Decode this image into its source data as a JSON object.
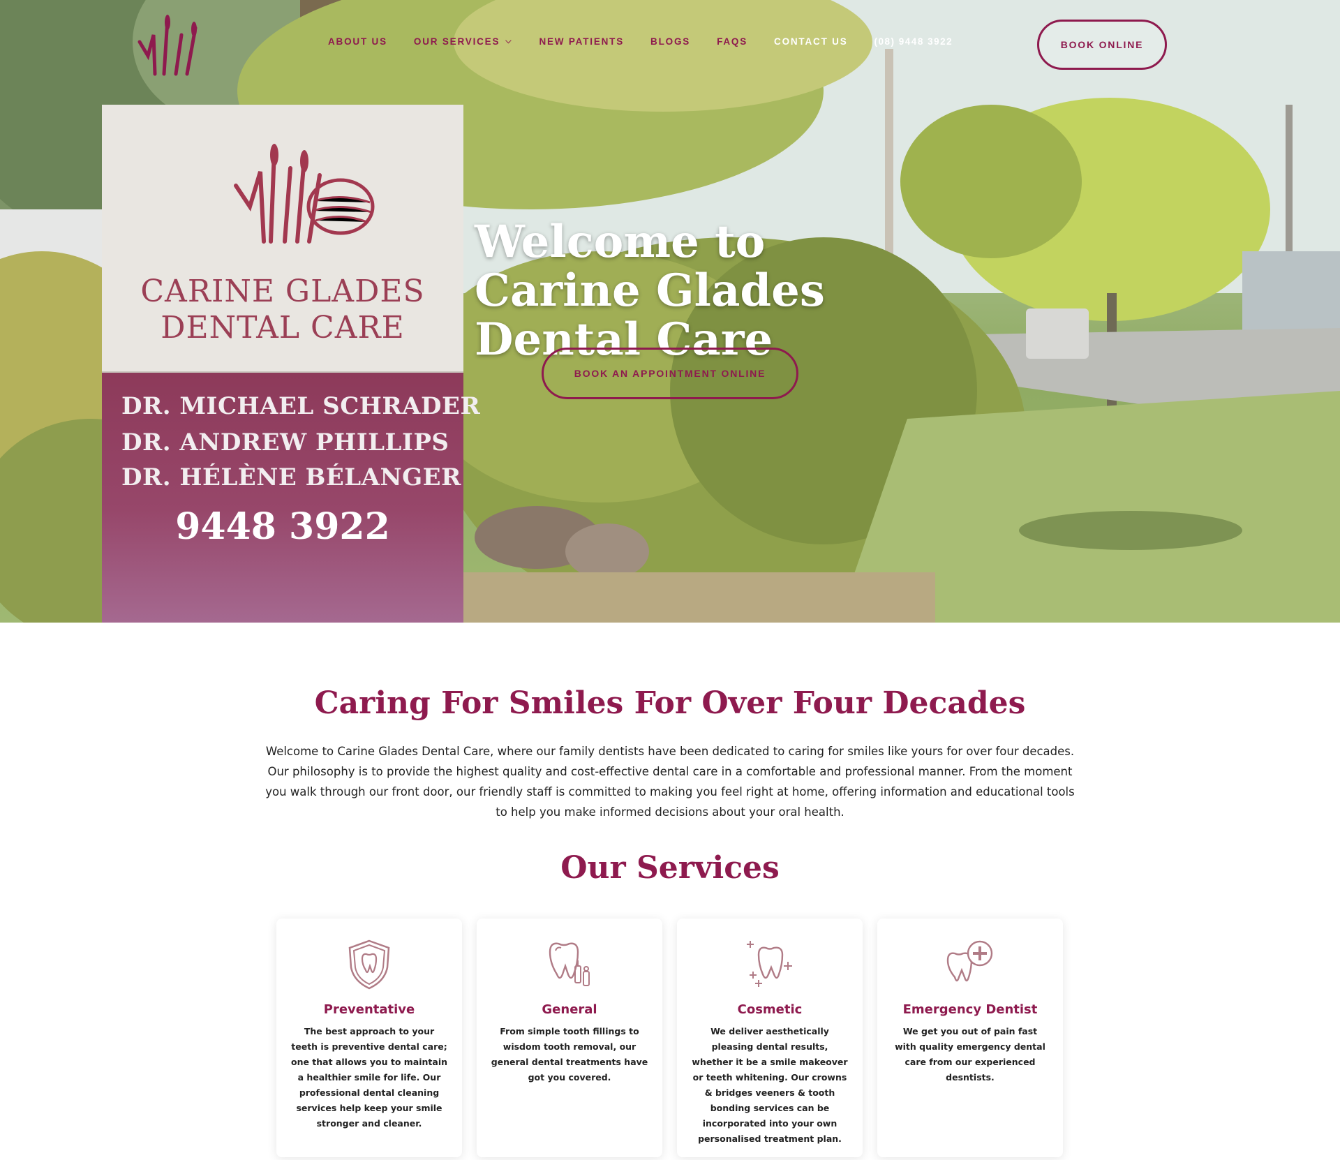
{
  "header": {
    "nav": [
      {
        "label": "ABOUT US",
        "has_dropdown": false
      },
      {
        "label": "OUR SERVICES",
        "has_dropdown": true
      },
      {
        "label": "NEW PATIENTS",
        "has_dropdown": false
      },
      {
        "label": "BLOGS",
        "has_dropdown": false
      },
      {
        "label": "FAQS",
        "has_dropdown": false
      },
      {
        "label": "CONTACT US",
        "has_dropdown": false
      }
    ],
    "phone": "(08) 9448 3922",
    "book_online_label": "BOOK ONLINE"
  },
  "hero": {
    "title": "Welcome to Carine Glades Dental Care",
    "cta_label": "BOOK AN APPOINTMENT ONLINE",
    "sign": {
      "name_line1": "CARINE GLADES",
      "name_line2": "DENTAL CARE",
      "doctors": [
        "DR. MICHAEL SCHRADER",
        "DR. ANDREW PHILLIPS",
        "DR. HÉLÈNE BÉLANGER"
      ],
      "phone": "9448 3922"
    }
  },
  "intro": {
    "title": "Caring For Smiles For Over Four Decades",
    "text": "Welcome to Carine Glades Dental Care, where our family dentists have been dedicated to caring for smiles like yours for over four decades. Our philosophy is to provide the highest quality and cost-effective dental care in a comfortable and professional manner. From the moment you walk through our front door, our friendly staff is committed to making you feel right at home, offering information and educational tools to help you make informed decisions about your oral health."
  },
  "services": {
    "title": "Our Services",
    "items": [
      {
        "icon": "shield-tooth-icon",
        "title": "Preventative",
        "text": "The best approach to your teeth is preventive dental care; one that allows you to maintain a healthier smile for life. Our professional dental cleaning services help keep your smile stronger and cleaner."
      },
      {
        "icon": "tooth-tools-icon",
        "title": "General",
        "text": "From simple tooth fillings to wisdom tooth removal, our general dental treatments have got you covered."
      },
      {
        "icon": "sparkle-tooth-icon",
        "title": "Cosmetic",
        "text": "We deliver aesthetically pleasing dental results, whether it be a smile makeover or teeth whitening. Our crowns & bridges veeners & tooth bonding services can be incorporated into your own personalised treatment plan."
      },
      {
        "icon": "emergency-tooth-icon",
        "title": "Emergency Dentist",
        "text": "We get you out of pain fast with quality emergency dental care from our experienced desntists."
      }
    ]
  },
  "colors": {
    "brand": "#8e1a4e",
    "white": "#ffffff"
  }
}
